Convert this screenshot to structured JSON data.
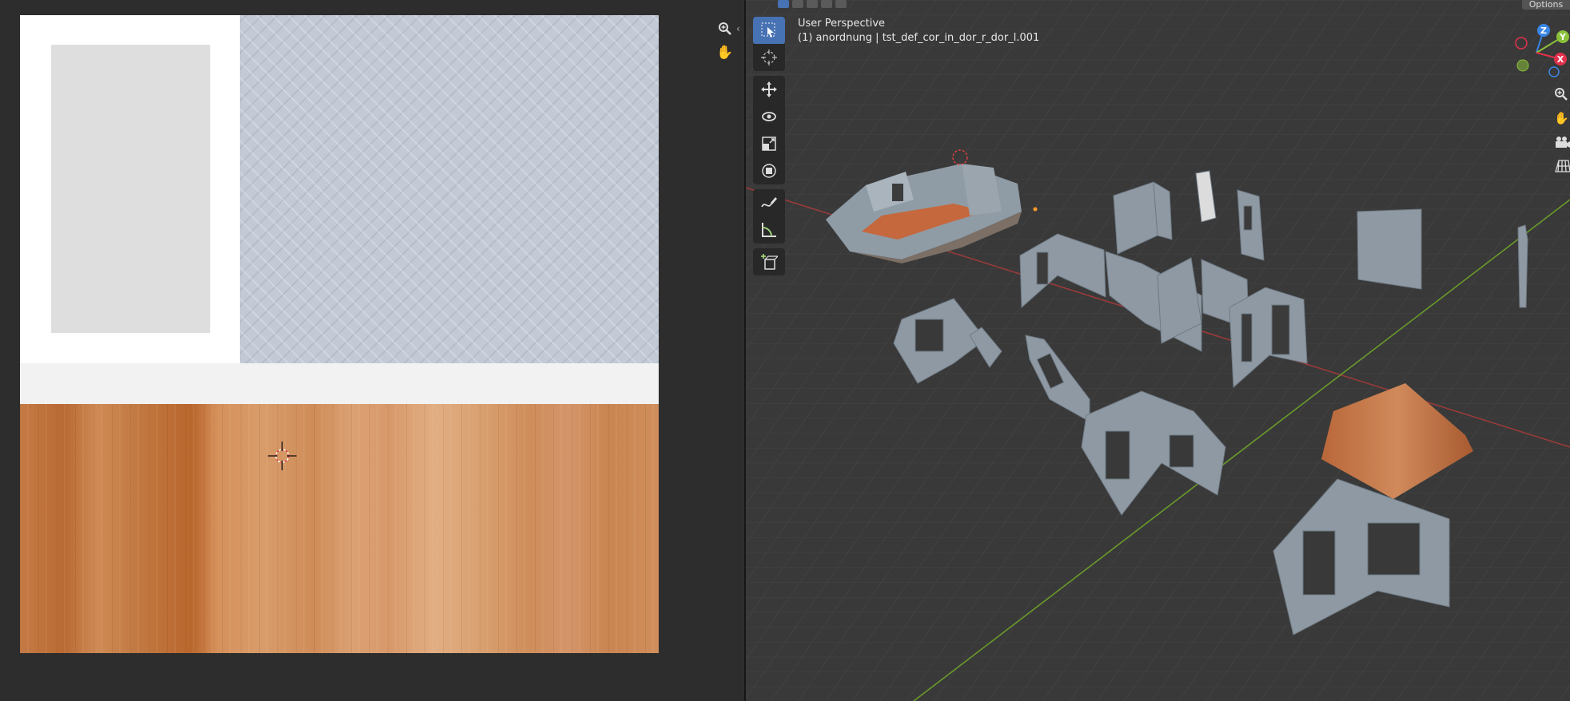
{
  "uv_editor": {
    "nav": {
      "zoom_icon": "zoom-icon",
      "pan_icon": "hand-icon",
      "collapse_icon": "chevron-left-icon"
    },
    "texture_colors": {
      "wallpaper": "#c3cad6",
      "white": "#ffffff",
      "panel": "#dedede",
      "strip": "#f2f2f2",
      "wood": "#c98551"
    }
  },
  "viewport": {
    "view_name": "User Perspective",
    "object_info": "(1) anordnung | tst_def_cor_in_dor_r_dor_l.001",
    "options_label": "Options",
    "toolbar": [
      {
        "name": "select-box-tool",
        "icon": "select-box-icon"
      },
      {
        "name": "cursor-tool",
        "icon": "cursor-icon"
      },
      {
        "name": "move-tool",
        "icon": "move-icon"
      },
      {
        "name": "rotate-tool",
        "icon": "rotate-icon"
      },
      {
        "name": "scale-tool",
        "icon": "scale-icon"
      },
      {
        "name": "transform-tool",
        "icon": "transform-icon"
      },
      {
        "name": "annotate-tool",
        "icon": "annotate-icon"
      },
      {
        "name": "measure-tool",
        "icon": "measure-icon"
      },
      {
        "name": "add-cube-tool",
        "icon": "add-cube-icon"
      }
    ],
    "gizmo": {
      "x_label": "X",
      "y_label": "Y",
      "z_label": "Z",
      "x_color": "#e2324b",
      "y_color": "#8bc13b",
      "z_color": "#3a86e6"
    },
    "nav_icons": [
      "zoom-icon",
      "hand-icon",
      "camera-icon",
      "grid-icon"
    ],
    "axis_colors": {
      "x_axis": "#9a3a3a",
      "y_axis": "#6a9a2a"
    }
  }
}
